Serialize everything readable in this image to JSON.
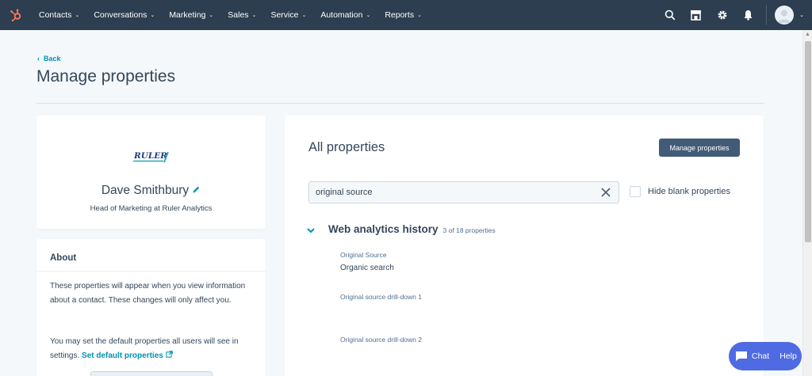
{
  "nav": {
    "items": [
      {
        "label": "Contacts"
      },
      {
        "label": "Conversations"
      },
      {
        "label": "Marketing"
      },
      {
        "label": "Sales"
      },
      {
        "label": "Service"
      },
      {
        "label": "Automation"
      },
      {
        "label": "Reports"
      }
    ],
    "chevron": "⌄"
  },
  "header": {
    "back_label": "Back",
    "title": "Manage properties"
  },
  "profile": {
    "logo_text": "RULER",
    "name": "Dave Smithbury",
    "role": "Head of Marketing at Ruler Analytics"
  },
  "about": {
    "title": "About",
    "text1": "These properties will appear when you view information about a contact. These changes will only affect you.",
    "text2_prefix": "You may set the default properties all users will see in settings.",
    "text2_link": "Set default properties"
  },
  "main": {
    "title": "All properties",
    "manage_button": "Manage properties",
    "search_value": "original source",
    "hide_blank_label": "Hide blank properties",
    "section": {
      "title": "Web analytics history",
      "count": "3 of 18 properties",
      "properties": [
        {
          "label": "Original Source",
          "value": "Organic search"
        },
        {
          "label": "Original source drill-down 1",
          "value": ""
        },
        {
          "label": "Original source drill-down 2",
          "value": ""
        }
      ]
    }
  },
  "chat": {
    "chat_label": "Chat",
    "help_label": "Help"
  },
  "colors": {
    "nav_bg": "#2d3e50",
    "accent_orange": "#ff7a59",
    "link": "#0091ae",
    "button_bg": "#425b76",
    "chat_bg": "#4f6be3"
  }
}
